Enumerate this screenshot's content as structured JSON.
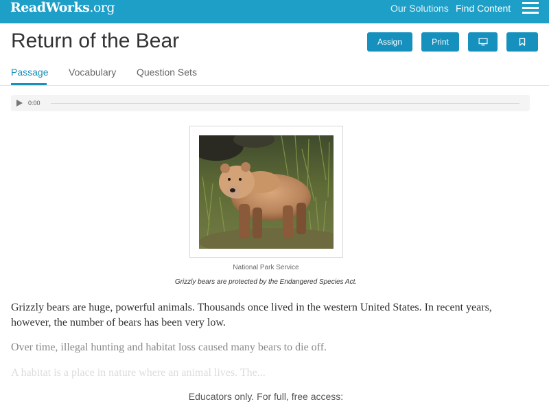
{
  "header": {
    "logo": {
      "word": "ReadWorks",
      "suffix": ".org"
    },
    "nav": {
      "our_solutions": "Our Solutions",
      "find_content": "Find Content"
    },
    "menu_icon": "hamburger-icon"
  },
  "page": {
    "title": "Return of the Bear",
    "buttons": {
      "assign": "Assign",
      "print": "Print",
      "present_icon": "monitor-icon",
      "bookmark_icon": "bookmark-icon"
    }
  },
  "tabs": [
    {
      "label": "Passage",
      "active": true
    },
    {
      "label": "Vocabulary",
      "active": false
    },
    {
      "label": "Question Sets",
      "active": false
    }
  ],
  "audio": {
    "time": "0:00",
    "play_icon": "play-icon"
  },
  "figure": {
    "credit": "National Park Service",
    "caption": "Grizzly bears are protected by the Endangered Species Act."
  },
  "passage": [
    "Grizzly bears are huge, powerful animals. Thousands once lived in the western United States. In recent years, however, the number of bears has been very low.",
    "Over time, illegal hunting and habitat loss caused many bears to die off.",
    "A habitat is a place in nature where an animal lives. The..."
  ],
  "footer": {
    "access_text": "Educators only. For full, free access:"
  },
  "colors": {
    "brand": "#1e9fc8",
    "button": "#1690bd",
    "active_tab": "#1a8fb9"
  }
}
